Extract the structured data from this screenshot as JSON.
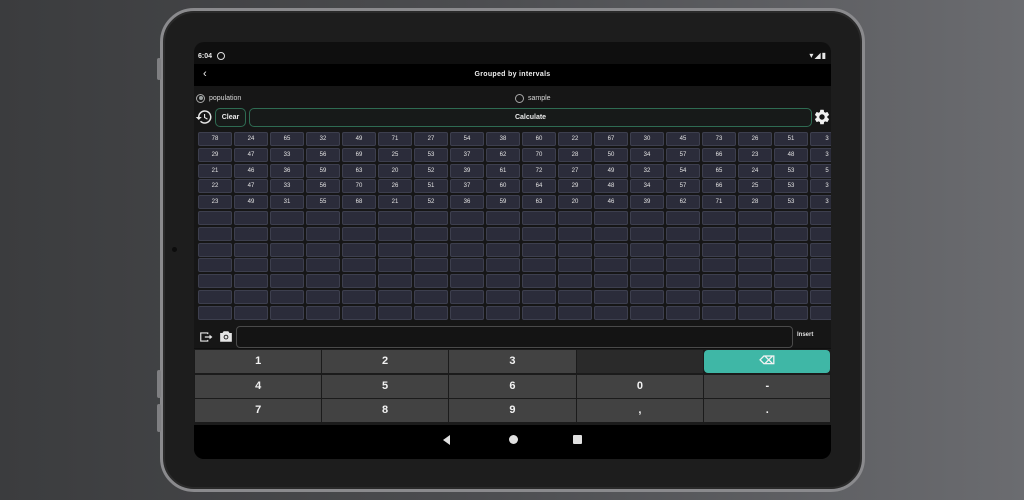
{
  "status": {
    "time": "6:04",
    "icons": [
      "wifi-icon",
      "signal-icon",
      "battery-icon"
    ]
  },
  "appbar": {
    "back_icon": "back-arrow-icon",
    "title": "Grouped by intervals"
  },
  "mode": {
    "population_label": "population",
    "sample_label": "sample",
    "selected": "population"
  },
  "toolbar": {
    "history_icon": "history-icon",
    "clear_label": "Clear",
    "calculate_label": "Calculate",
    "settings_icon": "gear-icon"
  },
  "grid": {
    "rows": [
      [
        "78",
        "24",
        "65",
        "32",
        "49",
        "71",
        "27",
        "54",
        "38",
        "60",
        "22",
        "67",
        "30",
        "45",
        "73",
        "26",
        "51",
        "3"
      ],
      [
        "29",
        "47",
        "33",
        "56",
        "69",
        "25",
        "53",
        "37",
        "62",
        "70",
        "28",
        "50",
        "34",
        "57",
        "66",
        "23",
        "48",
        "3"
      ],
      [
        "21",
        "46",
        "36",
        "59",
        "63",
        "20",
        "52",
        "39",
        "61",
        "72",
        "27",
        "49",
        "32",
        "54",
        "65",
        "24",
        "53",
        "5"
      ],
      [
        "22",
        "47",
        "33",
        "56",
        "70",
        "26",
        "51",
        "37",
        "60",
        "64",
        "29",
        "48",
        "34",
        "57",
        "66",
        "25",
        "53",
        "3"
      ],
      [
        "23",
        "49",
        "31",
        "55",
        "68",
        "21",
        "52",
        "36",
        "59",
        "63",
        "20",
        "46",
        "39",
        "62",
        "71",
        "28",
        "53",
        "3"
      ]
    ],
    "empty_rows": 7
  },
  "input": {
    "import_icon": "import-icon",
    "camera_icon": "camera-icon",
    "value": "",
    "insert_label": "Insert"
  },
  "keypad": {
    "rows": [
      [
        "1",
        "2",
        "3",
        "",
        "⌫"
      ],
      [
        "4",
        "5",
        "6",
        "0",
        "-"
      ],
      [
        "7",
        "8",
        "9",
        ",",
        "."
      ]
    ],
    "accent_color": "#3fb7a6"
  },
  "navbar": {
    "icons": [
      "nav-back-icon",
      "nav-home-icon",
      "nav-recent-icon"
    ]
  }
}
